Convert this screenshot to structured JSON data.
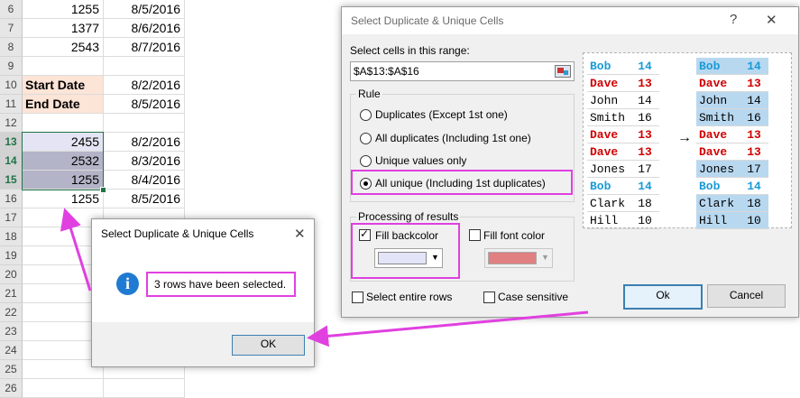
{
  "sheet": {
    "rows": [
      {
        "num": "6",
        "a": "1255",
        "b": "8/5/2016",
        "a_style": "num",
        "b_style": "datec"
      },
      {
        "num": "7",
        "a": "1377",
        "b": "8/6/2016",
        "a_style": "num",
        "b_style": "datec"
      },
      {
        "num": "8",
        "a": "2543",
        "b": "8/7/2016",
        "a_style": "num",
        "b_style": "datec"
      },
      {
        "num": "9",
        "a": "",
        "b": "",
        "a_style": "num",
        "b_style": "datec"
      },
      {
        "num": "10",
        "a": "Start Date",
        "b": "8/2/2016",
        "a_style": "bold lab",
        "b_style": "datec"
      },
      {
        "num": "11",
        "a": "End Date",
        "b": "8/5/2016",
        "a_style": "bold lab",
        "b_style": "datec"
      },
      {
        "num": "12",
        "a": "",
        "b": "",
        "a_style": "num",
        "b_style": "datec"
      },
      {
        "num": "13",
        "a": "2455",
        "b": "8/2/2016",
        "a_style": "num lav",
        "b_style": "datec",
        "sel": true
      },
      {
        "num": "14",
        "a": "2532",
        "b": "8/3/2016",
        "a_style": "num grey",
        "b_style": "datec",
        "sel": true
      },
      {
        "num": "15",
        "a": "1255",
        "b": "8/4/2016",
        "a_style": "num grey",
        "b_style": "datec",
        "sel": true
      },
      {
        "num": "16",
        "a": "1255",
        "b": "8/5/2016",
        "a_style": "num",
        "b_style": "datec"
      },
      {
        "num": "17",
        "a": "",
        "b": "",
        "a_style": "num",
        "b_style": "datec"
      },
      {
        "num": "18",
        "a": "",
        "b": "",
        "a_style": "num",
        "b_style": "datec"
      },
      {
        "num": "19",
        "a": "",
        "b": "",
        "a_style": "num",
        "b_style": "datec"
      },
      {
        "num": "20",
        "a": "",
        "b": "",
        "a_style": "num",
        "b_style": "datec"
      },
      {
        "num": "21",
        "a": "",
        "b": "",
        "a_style": "num",
        "b_style": "datec"
      },
      {
        "num": "22",
        "a": "",
        "b": "",
        "a_style": "num",
        "b_style": "datec"
      },
      {
        "num": "23",
        "a": "",
        "b": "",
        "a_style": "num",
        "b_style": "datec"
      },
      {
        "num": "24",
        "a": "",
        "b": "",
        "a_style": "num",
        "b_style": "datec"
      },
      {
        "num": "25",
        "a": "",
        "b": "",
        "a_style": "num",
        "b_style": "datec"
      },
      {
        "num": "26",
        "a": "",
        "b": "",
        "a_style": "num",
        "b_style": "datec"
      }
    ]
  },
  "main_dialog": {
    "title": "Select Duplicate & Unique Cells",
    "help_glyph": "?",
    "close_glyph": "✕",
    "range_label": "Select cells in this range:",
    "range_value": "$A$13:$A$16",
    "rule_label": "Rule",
    "rules": [
      "Duplicates (Except 1st one)",
      "All duplicates (Including 1st one)",
      "Unique values only",
      "All unique (Including 1st duplicates)"
    ],
    "processing_label": "Processing of results",
    "fill_backcolor": "Fill backcolor",
    "fill_font_color": "Fill font color",
    "backcolor_swatch": "#e4e4f8",
    "fontcolor_swatch": "#e08080",
    "select_entire_rows": "Select entire rows",
    "case_sensitive": "Case sensitive",
    "ok": "Ok",
    "cancel": "Cancel",
    "preview_left": [
      {
        "name": "Bob",
        "val": "14",
        "color": "#1a9bd7"
      },
      {
        "name": "Dave",
        "val": "13",
        "color": "#d00000"
      },
      {
        "name": "John",
        "val": "14",
        "color": "#000000"
      },
      {
        "name": "Smith",
        "val": "16",
        "color": "#000000"
      },
      {
        "name": "Dave",
        "val": "13",
        "color": "#d00000"
      },
      {
        "name": "Dave",
        "val": "13",
        "color": "#d00000"
      },
      {
        "name": "Jones",
        "val": "17",
        "color": "#000000"
      },
      {
        "name": "Bob",
        "val": "14",
        "color": "#1a9bd7"
      },
      {
        "name": "Clark",
        "val": "18",
        "color": "#000000"
      },
      {
        "name": "Hill",
        "val": "10",
        "color": "#000000"
      }
    ],
    "preview_right": [
      {
        "name": "Bob",
        "val": "14",
        "color": "#1a9bd7",
        "fill": true
      },
      {
        "name": "Dave",
        "val": "13",
        "color": "#d00000",
        "fill": false
      },
      {
        "name": "John",
        "val": "14",
        "color": "#000000",
        "fill": true
      },
      {
        "name": "Smith",
        "val": "16",
        "color": "#000000",
        "fill": true
      },
      {
        "name": "Dave",
        "val": "13",
        "color": "#d00000",
        "fill": false
      },
      {
        "name": "Dave",
        "val": "13",
        "color": "#d00000",
        "fill": false
      },
      {
        "name": "Jones",
        "val": "17",
        "color": "#000000",
        "fill": true
      },
      {
        "name": "Bob",
        "val": "14",
        "color": "#1a9bd7",
        "fill": false
      },
      {
        "name": "Clark",
        "val": "18",
        "color": "#000000",
        "fill": true
      },
      {
        "name": "Hill",
        "val": "10",
        "color": "#000000",
        "fill": true
      }
    ],
    "preview_fill_color": "#b8d8f0",
    "arrow_glyph": "→"
  },
  "msg_dialog": {
    "title": "Select Duplicate & Unique Cells",
    "close_glyph": "✕",
    "message": "3 rows have been selected.",
    "info_glyph": "i",
    "ok": "OK"
  },
  "accent_colors": {
    "highlight": "#e040e0",
    "excel_green": "#217346"
  }
}
